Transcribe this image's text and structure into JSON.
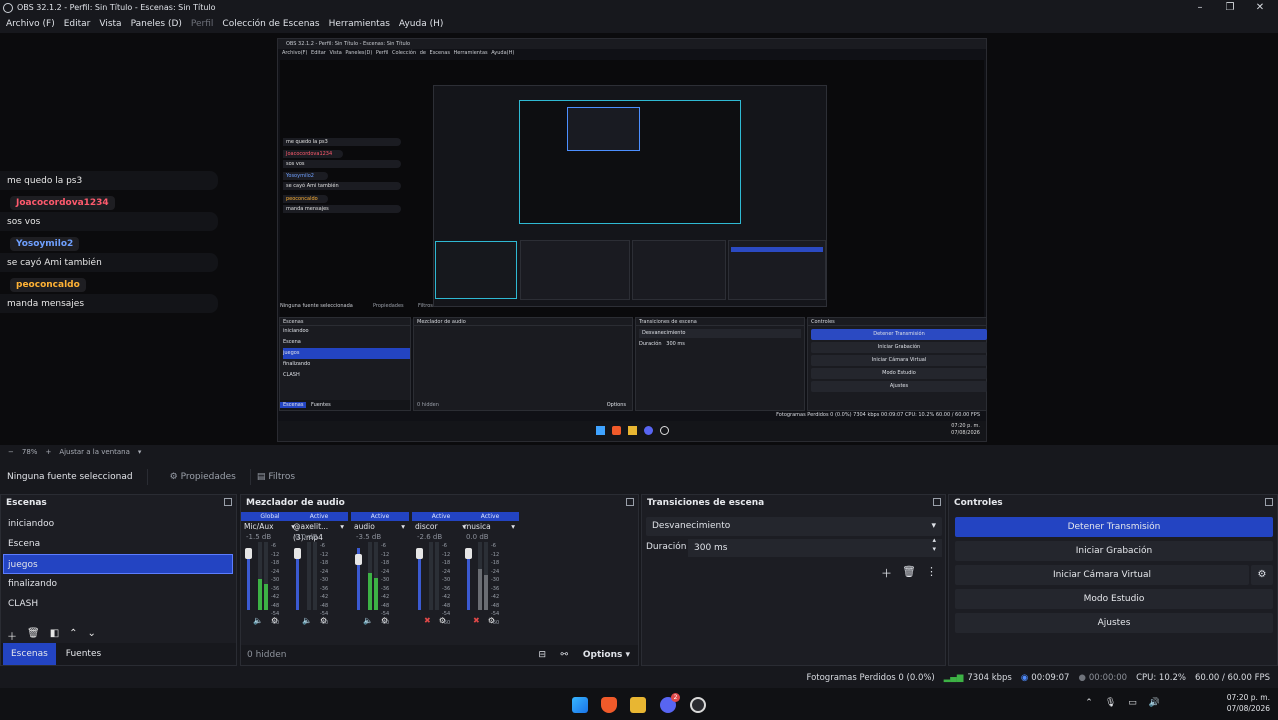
{
  "window": {
    "title": "OBS 32.1.2 - Perfil: Sin Título - Escenas: Sin Título"
  },
  "menu": [
    "Archivo (F)",
    "Editar",
    "Vista",
    "Paneles (D)",
    "Perfil",
    "Colección de Escenas",
    "Herramientas",
    "Ayuda (H)"
  ],
  "chat": [
    {
      "name": "",
      "text": "me quedo la ps3"
    },
    {
      "name": "Joacocordova1234",
      "text": "sos vos"
    },
    {
      "name": "Yosoymilo2",
      "text": "se cayó Ami también"
    },
    {
      "name": "peoconcaldo",
      "text": "manda mensajes"
    }
  ],
  "nested": {
    "title": "OBS 32.1.2 - Perfil: Sin Título - Escenas: Sin Título",
    "menu": "Archivo(F) Editar Vista Paneles(D) Perfil Colección de Escenas Herramientas Ayuda(H)",
    "no_source": "Ninguna fuente seleccionada",
    "props": "Propiedades",
    "filters": "Filtros",
    "scenes_header": "Escenas",
    "scenes": [
      "iniciandoo",
      "Escena",
      "juegos",
      "finalizando",
      "CLASH"
    ],
    "mixer_header": "Mezclador de audio",
    "trans_header": "Transiciones de escena",
    "trans_value": "Desvanecimiento",
    "duration": "Duración",
    "duration_value": "300 ms",
    "controls_header": "Controles",
    "controls": [
      "Detener Transmisión",
      "Iniciar Grabación",
      "Iniciar Cámara Virtual",
      "Modo Estudio",
      "Ajustes"
    ],
    "tab_scenes": "Escenas",
    "tab_sources": "Fuentes",
    "hidden": "0 hidden",
    "options": "Options",
    "status": "Fotogramas Perdidos 0 (0.0%)   7304 kbps   00:09:07   CPU: 10.2%   60.00 / 60.00 FPS",
    "time": "07:20 p. m.",
    "date": "07/08/2026"
  },
  "preview_toolbar": {
    "zoom": "78%",
    "fit": "Ajustar a la ventana"
  },
  "source_bar": {
    "none": "Ninguna fuente seleccionad",
    "properties": "Propiedades",
    "filters": "Filtros"
  },
  "scenes": {
    "header": "Escenas",
    "items": [
      "iniciandoo",
      "Escena",
      "juegos",
      "finalizando",
      "CLASH"
    ],
    "selected": 2,
    "tab_scenes": "Escenas",
    "tab_sources": "Fuentes"
  },
  "mixer": {
    "header": "Mezclador de audio",
    "strips": [
      {
        "head": "Global",
        "name": "Mic/Aux",
        "db": "-1.5 dB",
        "level": 0.45,
        "muted": false
      },
      {
        "head": "Active",
        "name": "@axelit...(3).mp4",
        "db": "0.0 dB",
        "level": 0.0,
        "muted": false
      },
      {
        "head": "Active",
        "name": "audio",
        "db": "-3.5 dB",
        "level": 0.55,
        "muted": false
      },
      {
        "head": "Active",
        "name": "discor",
        "db": "-2.6 dB",
        "level": 0.0,
        "muted": true
      },
      {
        "head": "Active",
        "name": "musica",
        "db": "0.0 dB",
        "level": 0.6,
        "muted": true
      }
    ],
    "ticks": [
      "-6",
      "-12",
      "-18",
      "-24",
      "-30",
      "-36",
      "-42",
      "-48",
      "-54",
      "-60"
    ],
    "hidden": "0 hidden",
    "options": "Options"
  },
  "transitions": {
    "header": "Transiciones de escena",
    "selected": "Desvanecimiento",
    "duration_label": "Duración",
    "duration_value": "300 ms"
  },
  "controls": {
    "header": "Controles",
    "stop_stream": "Detener Transmisión",
    "start_record": "Iniciar Grabación",
    "virtual_cam": "Iniciar Cámara Virtual",
    "studio": "Modo Estudio",
    "settings": "Ajustes"
  },
  "status": {
    "dropped": "Fotogramas Perdidos 0 (0.0%)",
    "bitrate": "7304 kbps",
    "stream_time": "00:09:07",
    "rec_time": "00:00:00",
    "cpu": "CPU: 10.2%",
    "fps": "60.00 / 60.00 FPS"
  },
  "taskbar": {
    "time": "07:20 p. m.",
    "date": "07/08/2026",
    "discord_badge": "2"
  },
  "colors": {
    "accent": "#2344c2",
    "meter_green": "#3db245",
    "muted_red": "#e04848"
  }
}
